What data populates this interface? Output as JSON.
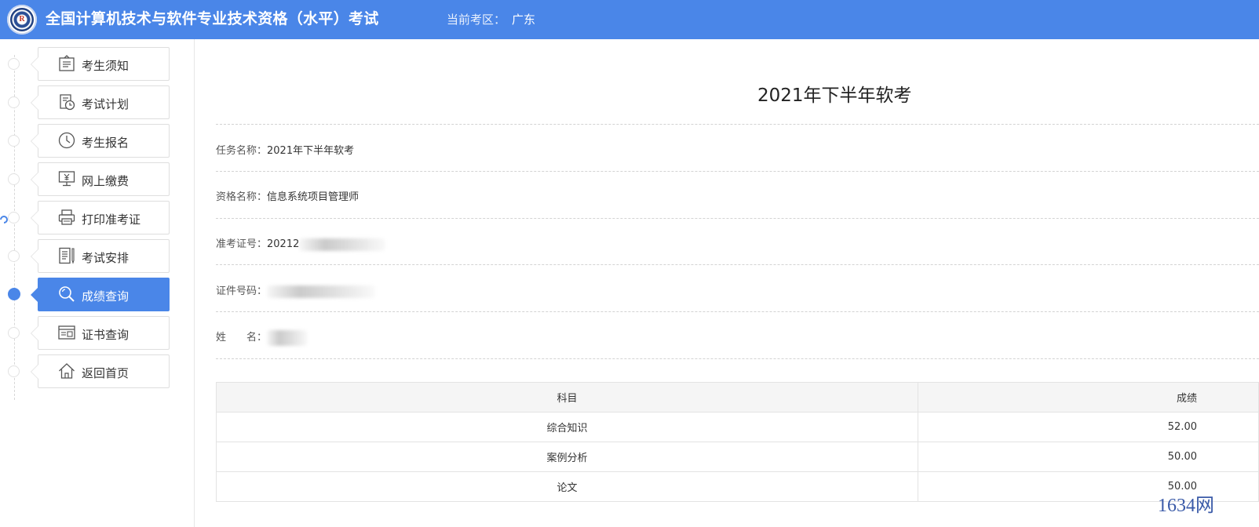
{
  "header": {
    "title": "全国计算机技术与软件专业技术资格（水平）考试",
    "region_label": "当前考区：",
    "region_value": "广东",
    "bg_color": "#4a86e8"
  },
  "sidebar": {
    "items": [
      {
        "label": "考生须知",
        "icon": "notice-board-icon"
      },
      {
        "label": "考试计划",
        "icon": "calendar-clock-icon"
      },
      {
        "label": "考生报名",
        "icon": "clock-icon"
      },
      {
        "label": "网上缴费",
        "icon": "monitor-yen-icon"
      },
      {
        "label": "打印准考证",
        "icon": "printer-icon"
      },
      {
        "label": "考试安排",
        "icon": "document-pen-icon"
      },
      {
        "label": "成绩查询",
        "icon": "search-icon",
        "active": true
      },
      {
        "label": "证书查询",
        "icon": "certificate-icon"
      },
      {
        "label": "返回首页",
        "icon": "home-icon"
      }
    ],
    "active_index": 6
  },
  "main": {
    "title": "2021年下半年软考",
    "info": {
      "task": {
        "label": "任务名称：",
        "value": "2021年下半年软考"
      },
      "qualification": {
        "label": "资格名称：",
        "value": "信息系统项目管理师"
      },
      "admission_no": {
        "label": "准考证号：",
        "value": "20212"
      },
      "id_no": {
        "label": "证件号码：",
        "value": ""
      },
      "name": {
        "label": "姓　　名：",
        "value": ""
      }
    },
    "table": {
      "headers": [
        "科目",
        "成绩"
      ],
      "rows": [
        {
          "subject": "综合知识",
          "score": "52.00"
        },
        {
          "subject": "案例分析",
          "score": "50.00"
        },
        {
          "subject": "论文",
          "score": "50.00"
        }
      ]
    }
  },
  "watermark": "1634网"
}
